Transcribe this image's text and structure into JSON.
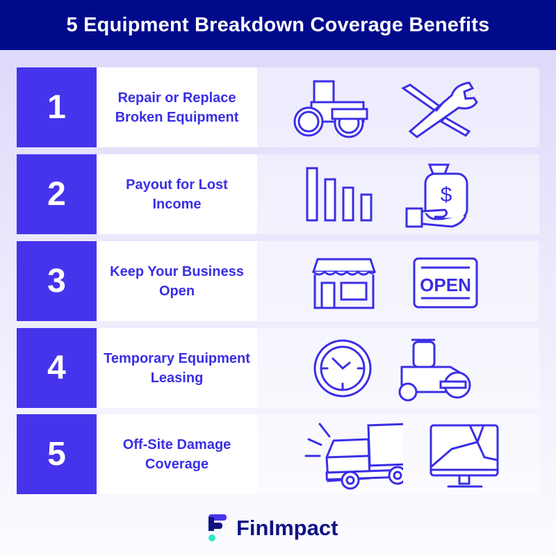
{
  "title": "5 Equipment Breakdown Coverage Benefits",
  "benefits": [
    {
      "number": "1",
      "label": "Repair or Replace Broken Equipment",
      "icons": [
        "road-roller-icon",
        "tools-icon"
      ]
    },
    {
      "number": "2",
      "label": "Payout for Lost Income",
      "icons": [
        "declining-bars-icon",
        "money-bag-hand-icon"
      ]
    },
    {
      "number": "3",
      "label": "Keep Your Business Open",
      "icons": [
        "storefront-icon",
        "open-sign-icon"
      ]
    },
    {
      "number": "4",
      "label": "Temporary Equipment Leasing",
      "icons": [
        "clock-icon",
        "road-roller-icon"
      ]
    },
    {
      "number": "5",
      "label": "Off-Site Damage Coverage",
      "icons": [
        "crashed-truck-icon",
        "broken-monitor-icon"
      ]
    }
  ],
  "open_sign_text": "OPEN",
  "brand": {
    "name": "FinImpact",
    "colors": {
      "header": "#020a8c",
      "accent": "#4634ec",
      "text": "#3a2ee6",
      "logo_teal": "#2ee6c8"
    }
  }
}
